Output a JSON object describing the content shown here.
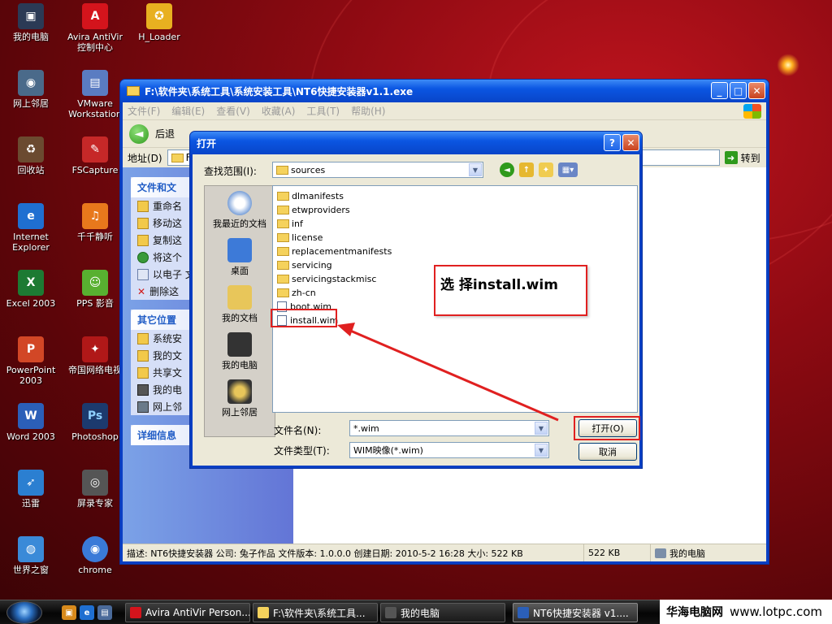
{
  "desktop": {
    "icons": [
      {
        "label": "我的电脑",
        "icon": "my-computer-icon",
        "color": "#2b3a55"
      },
      {
        "label": "网上邻居",
        "icon": "network-places-icon",
        "color": "#4a6a8a"
      },
      {
        "label": "回收站",
        "icon": "recycle-bin-icon",
        "color": "#6b4a30"
      },
      {
        "label": "Internet Explorer",
        "icon": "ie-icon",
        "color": "#1f6fd1"
      },
      {
        "label": "Excel 2003",
        "icon": "excel-icon",
        "color": "#1d7a33"
      },
      {
        "label": "PowerPoint 2003",
        "icon": "powerpoint-icon",
        "color": "#d24726"
      },
      {
        "label": "Word 2003",
        "icon": "word-icon",
        "color": "#2b5fb8"
      },
      {
        "label": "迅雷",
        "icon": "xunlei-icon",
        "color": "#2b7fd1"
      },
      {
        "label": "世界之窗",
        "icon": "theworld-icon",
        "color": "#3a8ad8"
      },
      {
        "label": "Avira AntiVir 控制中心",
        "icon": "avira-icon",
        "color": "#d4141c"
      },
      {
        "label": "VMware Workstation",
        "icon": "vmware-icon",
        "color": "#5a7cc2"
      },
      {
        "label": "FSCapture",
        "icon": "fscapture-icon",
        "color": "#c62828"
      },
      {
        "label": "千千静听",
        "icon": "ttplayer-icon",
        "color": "#e8781c"
      },
      {
        "label": "PPS 影音",
        "icon": "pps-icon",
        "color": "#58b030"
      },
      {
        "label": "帝国网络电视",
        "icon": "tv-icon",
        "color": "#b01818"
      },
      {
        "label": "Photoshop",
        "icon": "photoshop-icon",
        "color": "#1c3a6e"
      },
      {
        "label": "屏录专家",
        "icon": "screen-recorder-icon",
        "color": "#555555"
      },
      {
        "label": "chrome",
        "icon": "chrome-icon",
        "color": "#3a7ad8"
      },
      {
        "label": "H_Loader",
        "icon": "hloader-icon",
        "color": "#e8b020"
      }
    ]
  },
  "explorer": {
    "title": "F:\\软件夹\\系统工具\\系统安装工具\\NT6快捷安装器v1.1.exe",
    "menu": [
      "文件(F)",
      "编辑(E)",
      "查看(V)",
      "收藏(A)",
      "工具(T)",
      "帮助(H)"
    ],
    "back_label": "后退",
    "address_label": "地址(D)",
    "address_value": "F",
    "go_label": "转到",
    "pane1_title": "文件和文",
    "pane1_items": [
      "重命名",
      "移动这",
      "复制这",
      "将这个",
      "以电子 文件",
      "删除这"
    ],
    "pane2_title": "其它位置",
    "pane2_items": [
      "系统安",
      "我的文",
      "共享文",
      "我的电",
      "网上邻"
    ],
    "pane3_title": "详细信息",
    "status_desc": "描述: NT6快捷安装器 公司: 兔子作品 文件版本: 1.0.0.0 创建日期: 2010-5-2 16:28 大小: 522 KB",
    "status_size": "522 KB",
    "status_location": "我的电脑"
  },
  "dialog": {
    "title": "打开",
    "look_in_label": "查找范围(I):",
    "look_in_value": "sources",
    "places": [
      "我最近的文档",
      "桌面",
      "我的文档",
      "我的电脑",
      "网上邻居"
    ],
    "files": [
      {
        "name": "dlmanifests",
        "type": "folder"
      },
      {
        "name": "etwproviders",
        "type": "folder"
      },
      {
        "name": "inf",
        "type": "folder"
      },
      {
        "name": "license",
        "type": "folder"
      },
      {
        "name": "replacementmanifests",
        "type": "folder"
      },
      {
        "name": "servicing",
        "type": "folder"
      },
      {
        "name": "servicingstackmisc",
        "type": "folder"
      },
      {
        "name": "zh-cn",
        "type": "folder"
      },
      {
        "name": "boot.wim",
        "type": "file"
      },
      {
        "name": "install.wim",
        "type": "file"
      }
    ],
    "annotation": "选 择install.wim",
    "filename_label": "文件名(N):",
    "filename_value": "*.wim",
    "filetype_label": "文件类型(T):",
    "filetype_value": "WIM映像(*.wim)",
    "open_label": "打开(O)",
    "cancel_label": "取消"
  },
  "taskbar": {
    "buttons": [
      {
        "label": "Avira AntiVir Person...",
        "color": "#d4141c"
      },
      {
        "label": "F:\\软件夹\\系统工具...",
        "color": "#f5d25c"
      },
      {
        "label": "我的电脑",
        "color": "#555555"
      },
      {
        "label": "NT6快捷安装器 v1....",
        "color": "#2b5fb8"
      }
    ]
  },
  "watermark": {
    "site_cn": "华海电脑网",
    "url": "www.lotpc.com"
  },
  "colors": {
    "highlight": "#e02020",
    "xp_blue": "#0a3fc4"
  }
}
